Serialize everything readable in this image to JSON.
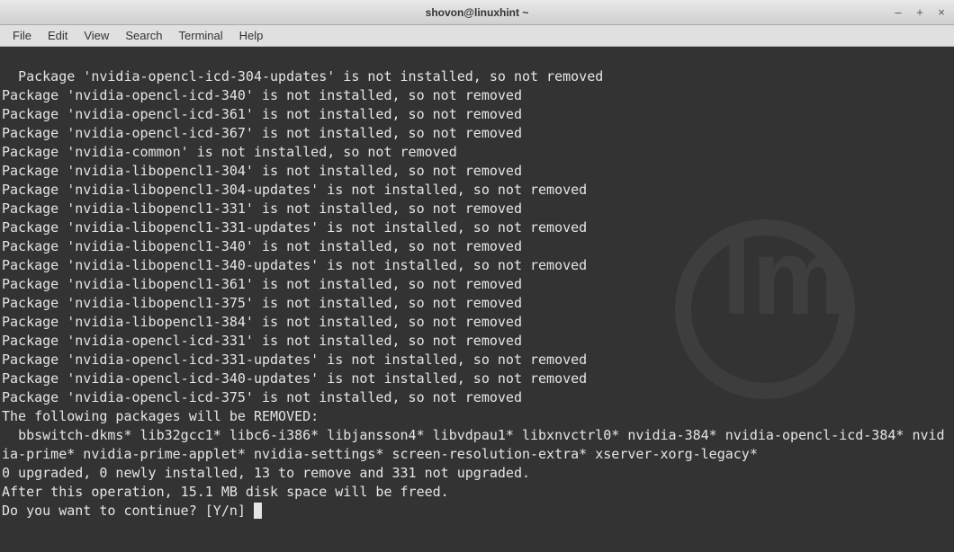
{
  "window": {
    "title": "shovon@linuxhint ~"
  },
  "menubar": {
    "items": [
      {
        "label": "File"
      },
      {
        "label": "Edit"
      },
      {
        "label": "View"
      },
      {
        "label": "Search"
      },
      {
        "label": "Terminal"
      },
      {
        "label": "Help"
      }
    ]
  },
  "terminal": {
    "lines": [
      "Package 'nvidia-opencl-icd-304-updates' is not installed, so not removed",
      "Package 'nvidia-opencl-icd-340' is not installed, so not removed",
      "Package 'nvidia-opencl-icd-361' is not installed, so not removed",
      "Package 'nvidia-opencl-icd-367' is not installed, so not removed",
      "Package 'nvidia-common' is not installed, so not removed",
      "Package 'nvidia-libopencl1-304' is not installed, so not removed",
      "Package 'nvidia-libopencl1-304-updates' is not installed, so not removed",
      "Package 'nvidia-libopencl1-331' is not installed, so not removed",
      "Package 'nvidia-libopencl1-331-updates' is not installed, so not removed",
      "Package 'nvidia-libopencl1-340' is not installed, so not removed",
      "Package 'nvidia-libopencl1-340-updates' is not installed, so not removed",
      "Package 'nvidia-libopencl1-361' is not installed, so not removed",
      "Package 'nvidia-libopencl1-375' is not installed, so not removed",
      "Package 'nvidia-libopencl1-384' is not installed, so not removed",
      "Package 'nvidia-opencl-icd-331' is not installed, so not removed",
      "Package 'nvidia-opencl-icd-331-updates' is not installed, so not removed",
      "Package 'nvidia-opencl-icd-340-updates' is not installed, so not removed",
      "Package 'nvidia-opencl-icd-375' is not installed, so not removed",
      "The following packages will be REMOVED:",
      "  bbswitch-dkms* lib32gcc1* libc6-i386* libjansson4* libvdpau1* libxnvctrl0* nvidia-384* nvidia-opencl-icd-384* nvidia-prime* nvidia-prime-applet* nvidia-settings* screen-resolution-extra* xserver-xorg-legacy*",
      "0 upgraded, 0 newly installed, 13 to remove and 331 not upgraded.",
      "After this operation, 15.1 MB disk space will be freed.",
      "Do you want to continue? [Y/n] "
    ]
  }
}
